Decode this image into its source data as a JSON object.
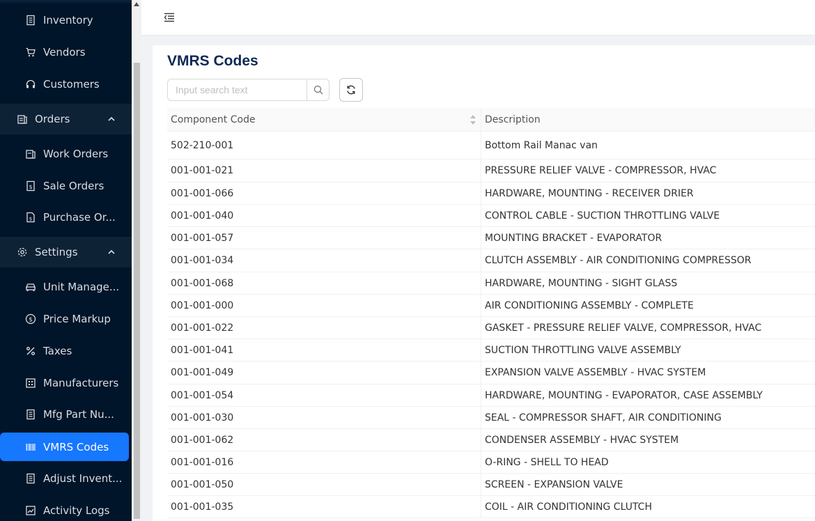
{
  "sidebar": {
    "items": [
      {
        "label": "Inventory",
        "icon": "inventory-icon",
        "type": "sub"
      },
      {
        "label": "Vendors",
        "icon": "cart-icon",
        "type": "sub"
      },
      {
        "label": "Customers",
        "icon": "headset-icon",
        "type": "sub"
      },
      {
        "label": "Orders",
        "icon": "orders-icon",
        "type": "group"
      },
      {
        "label": "Work Orders",
        "icon": "work-orders-icon",
        "type": "sub"
      },
      {
        "label": "Sale Orders",
        "icon": "sale-orders-icon",
        "type": "sub"
      },
      {
        "label": "Purchase Or...",
        "icon": "purchase-orders-icon",
        "type": "sub"
      },
      {
        "label": "Settings",
        "icon": "gear-icon",
        "type": "group"
      },
      {
        "label": "Unit Manage...",
        "icon": "car-icon",
        "type": "sub"
      },
      {
        "label": "Price Markup",
        "icon": "dollar-icon",
        "type": "sub"
      },
      {
        "label": "Taxes",
        "icon": "percent-icon",
        "type": "sub"
      },
      {
        "label": "Manufacturers",
        "icon": "factory-icon",
        "type": "sub"
      },
      {
        "label": "Mfg Part Nu...",
        "icon": "list-icon",
        "type": "sub"
      },
      {
        "label": "VMRS Codes",
        "icon": "barcode-icon",
        "type": "sub",
        "active": true
      },
      {
        "label": "Adjust Invent...",
        "icon": "adjust-icon",
        "type": "sub"
      },
      {
        "label": "Activity Logs",
        "icon": "chart-icon",
        "type": "sub"
      }
    ]
  },
  "page": {
    "title": "VMRS Codes",
    "search_placeholder": "Input search text"
  },
  "table": {
    "columns": [
      "Component Code",
      "Description"
    ],
    "rows": [
      [
        "502-210-001",
        "Bottom Rail Manac van"
      ],
      [
        "001-001-021",
        "PRESSURE RELIEF VALVE - COMPRESSOR, HVAC"
      ],
      [
        "001-001-066",
        "HARDWARE, MOUNTING - RECEIVER DRIER"
      ],
      [
        "001-001-040",
        "CONTROL CABLE - SUCTION THROTTLING VALVE"
      ],
      [
        "001-001-057",
        "MOUNTING BRACKET - EVAPORATOR"
      ],
      [
        "001-001-034",
        "CLUTCH ASSEMBLY - AIR CONDITIONING COMPRESSOR"
      ],
      [
        "001-001-068",
        "HARDWARE, MOUNTING - SIGHT GLASS"
      ],
      [
        "001-001-000",
        "AIR CONDITIONING ASSEMBLY - COMPLETE"
      ],
      [
        "001-001-022",
        "GASKET - PRESSURE RELIEF VALVE, COMPRESSOR, HVAC"
      ],
      [
        "001-001-041",
        "SUCTION THROTTLING VALVE ASSEMBLY"
      ],
      [
        "001-001-049",
        "EXPANSION VALVE ASSEMBLY - HVAC SYSTEM"
      ],
      [
        "001-001-054",
        "HARDWARE, MOUNTING - EVAPORATOR, CASE ASSEMBLY"
      ],
      [
        "001-001-030",
        "SEAL - COMPRESSOR SHAFT, AIR CONDITIONING"
      ],
      [
        "001-001-062",
        "CONDENSER ASSEMBLY - HVAC SYSTEM"
      ],
      [
        "001-001-016",
        "O-RING - SHELL TO HEAD"
      ],
      [
        "001-001-050",
        "SCREEN - EXPANSION VALVE"
      ],
      [
        "001-001-035",
        "COIL - AIR CONDITIONING CLUTCH"
      ]
    ]
  },
  "colors": {
    "sidebar_bg": "#001529",
    "active_bg": "#1677ff",
    "title": "#0d2a54"
  }
}
